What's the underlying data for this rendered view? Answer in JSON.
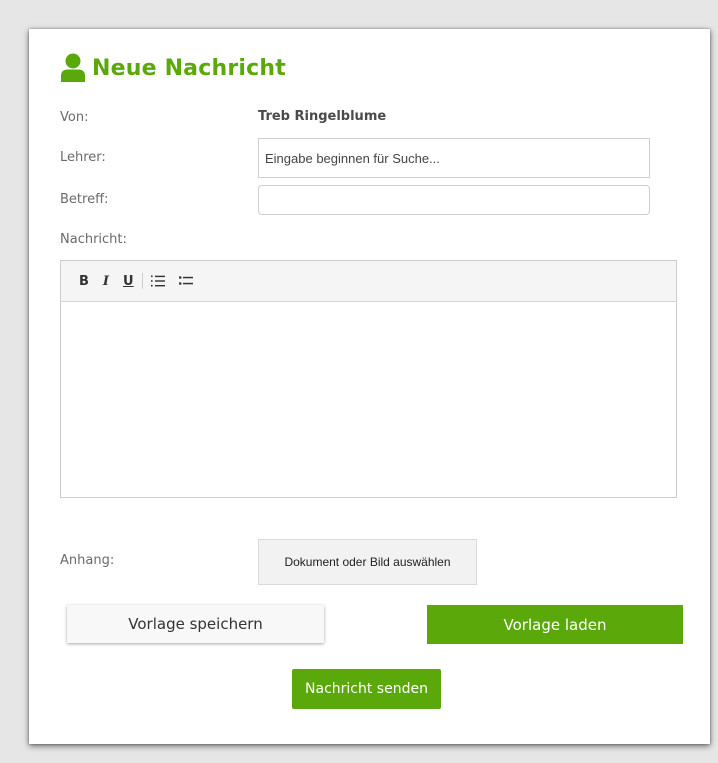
{
  "header": {
    "title": "Neue Nachricht",
    "icon": "user-icon",
    "accent_color": "#5aa80a"
  },
  "form": {
    "from_label": "Von:",
    "from_value": "Treb Ringelblume",
    "teacher_label": "Lehrer:",
    "teacher_placeholder": "Eingabe beginnen für Suche...",
    "teacher_value": "",
    "subject_label": "Betreff:",
    "subject_value": "",
    "message_label": "Nachricht:",
    "message_value": "",
    "attachment_label": "Anhang:",
    "attachment_button": "Dokument oder Bild auswählen"
  },
  "toolbar": {
    "bold": "B",
    "italic": "I",
    "underline": "U",
    "ordered_list_icon": "ordered-list-icon",
    "unordered_list_icon": "unordered-list-icon"
  },
  "actions": {
    "save_template": "Vorlage speichern",
    "load_template": "Vorlage laden",
    "send": "Nachricht senden"
  }
}
